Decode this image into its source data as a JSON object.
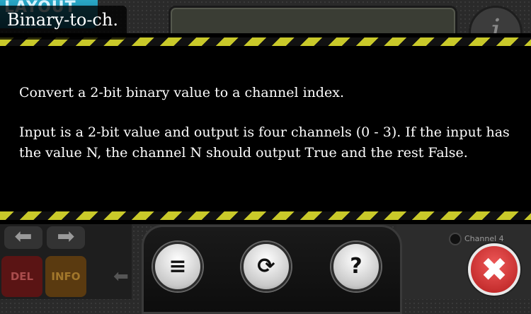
{
  "background": {
    "layout_button_label": "LAYOUT",
    "info_icon_glyph": "i",
    "left_panel": {
      "back_arrow_glyph": "⬅",
      "forward_arrow_glyph": "➡",
      "del_label": "DEL",
      "info_label": "INFO",
      "small_arrow_glyph": "⬅"
    },
    "right_panel": {
      "channel_label": "Channel 4"
    }
  },
  "modal": {
    "title": "Binary-to-ch.",
    "paragraphs": [
      "Convert a 2-bit binary value to a channel index.",
      "Input is a 2-bit value and output is four channels (0 - 3). If the input has the value N, the channel N should output True and the rest False."
    ]
  },
  "toolbar": {
    "menu_icon": "≡",
    "reset_icon": "⟳",
    "help_icon": "?",
    "close_icon": "✖"
  },
  "colors": {
    "hazard_yellow": "#c9c92a",
    "close_red": "#d63a3a",
    "layout_blue": "#1f8fb0"
  }
}
